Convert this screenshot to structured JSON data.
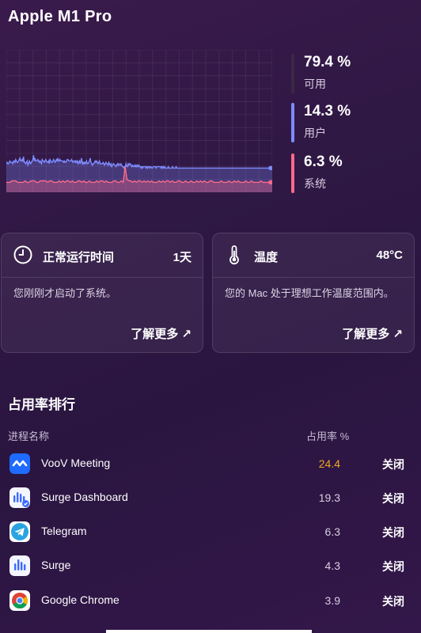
{
  "window": {
    "title": "Apple M1 Pro"
  },
  "cpu_stats": [
    {
      "value": "79.4 %",
      "label": "可用",
      "color": "#3a2a44"
    },
    {
      "value": "14.3 %",
      "label": "用户",
      "color": "#7d8cff"
    },
    {
      "value": "6.3 %",
      "label": "系统",
      "color": "#ff6a8a"
    }
  ],
  "chart_data": {
    "type": "area",
    "series": [
      {
        "name": "用户",
        "color": "#7d8cff",
        "values": [
          20,
          21,
          20,
          20,
          21,
          22,
          21,
          21,
          21,
          20,
          22,
          22,
          21,
          23,
          22,
          21,
          21,
          22,
          23,
          24,
          22,
          22,
          23,
          22,
          25,
          21,
          21,
          20,
          21,
          22,
          19,
          20,
          22,
          21,
          20,
          21,
          22,
          23,
          26,
          22,
          24,
          22,
          22,
          22,
          23,
          22,
          21,
          22,
          21,
          20,
          23,
          22,
          22,
          21,
          22,
          23,
          22,
          21,
          21,
          22,
          20,
          23,
          22,
          21,
          21,
          22,
          23,
          22,
          21,
          22,
          23,
          22,
          24,
          22,
          22,
          23,
          22,
          22,
          22,
          22,
          21,
          22,
          21,
          21,
          22,
          23,
          23,
          22,
          22,
          22,
          22,
          23,
          22,
          21,
          22,
          22,
          21,
          22,
          21,
          22,
          20,
          21,
          22,
          20,
          22,
          24,
          20,
          21,
          20,
          21,
          20,
          21,
          22,
          20,
          20,
          21,
          22,
          24,
          21,
          20,
          19,
          20,
          20,
          21,
          22,
          21,
          22,
          21,
          20,
          21,
          22,
          20,
          20,
          20,
          20,
          21,
          20,
          19,
          20,
          21,
          20,
          20,
          19,
          21,
          20,
          19,
          20,
          18,
          19,
          20,
          20,
          19,
          19,
          18,
          19,
          20,
          19,
          20,
          19,
          19,
          20,
          19,
          18,
          18,
          17,
          18,
          18,
          20,
          18,
          18,
          20,
          19,
          20,
          20,
          19,
          18,
          19,
          18,
          18,
          19,
          18,
          19,
          18,
          19,
          18,
          19,
          18,
          18,
          17,
          18,
          17,
          18,
          18,
          18,
          18,
          17,
          18,
          17,
          18,
          18,
          17,
          18,
          18,
          17,
          17,
          18,
          18,
          18,
          18,
          17,
          18,
          18,
          18,
          18,
          18,
          18,
          17,
          18,
          17,
          18,
          17,
          18,
          17,
          17,
          17,
          17,
          18,
          17,
          17,
          17,
          17,
          17,
          18,
          17,
          17,
          17,
          17,
          18,
          17,
          17,
          17,
          17,
          17,
          17,
          17,
          17,
          17,
          17,
          17,
          17,
          17,
          17,
          17,
          17,
          17,
          17,
          17,
          17,
          17,
          17,
          17,
          17,
          17,
          17,
          17,
          17,
          17,
          17,
          17,
          17,
          17,
          17,
          17,
          17,
          17,
          17,
          17,
          17,
          17,
          17,
          17,
          17,
          17,
          17,
          17,
          17,
          17,
          17,
          17,
          17,
          17,
          17,
          17,
          17,
          17,
          17,
          17,
          17,
          17,
          17,
          17,
          17,
          17,
          17,
          17,
          17,
          17,
          17,
          17,
          17,
          17,
          17,
          17,
          17,
          17,
          17,
          17,
          17,
          17,
          17,
          17,
          17,
          17,
          17,
          17,
          17,
          17,
          17,
          17,
          17,
          17,
          17,
          17,
          17,
          17,
          17,
          17,
          17,
          17,
          17,
          17,
          17,
          17,
          17,
          17,
          17,
          17,
          17,
          17,
          17,
          17,
          17,
          17,
          17,
          17,
          17,
          17,
          17,
          17,
          17,
          17,
          17,
          17,
          17,
          17,
          17,
          17,
          17,
          17,
          17,
          17,
          17
        ]
      },
      {
        "name": "系统",
        "color": "#ff6a8a",
        "values": [
          7,
          7,
          7,
          8,
          8,
          8,
          7,
          7,
          7,
          7,
          8,
          7,
          7,
          8,
          8,
          8,
          7,
          7,
          8,
          8,
          8,
          8,
          7,
          8,
          8,
          7,
          7,
          7,
          8,
          7,
          8,
          7,
          8,
          8,
          7,
          8,
          7,
          7,
          8,
          8,
          7,
          8,
          7,
          7,
          8,
          7,
          7,
          7,
          8,
          7,
          8,
          8,
          7,
          8,
          7,
          7,
          7,
          8,
          8,
          7,
          7,
          8,
          7,
          18,
          9,
          8,
          8,
          7,
          8,
          7,
          8,
          8,
          7,
          8,
          7,
          8,
          7,
          8,
          7,
          7,
          7,
          8,
          7,
          8,
          7,
          8,
          8,
          7,
          8,
          7,
          7,
          8,
          8,
          7,
          7,
          8,
          7,
          7,
          8,
          7,
          7,
          8,
          7,
          8,
          7,
          8,
          7,
          7,
          8,
          8,
          7,
          7,
          7,
          7,
          8,
          7,
          7,
          7,
          8,
          7,
          7,
          8,
          7,
          8,
          7,
          7,
          7,
          8,
          7,
          7,
          8,
          7,
          7,
          7,
          7,
          8,
          7,
          7,
          7,
          7,
          6,
          7
        ]
      }
    ],
    "ylim": [
      0,
      100
    ],
    "grid": true
  },
  "cards": {
    "uptime": {
      "title": "正常运行时间",
      "value": "1天",
      "desc": "您刚刚才启动了系统。",
      "more": "了解更多 ↗"
    },
    "temp": {
      "title": "温度",
      "value": "48°C",
      "desc": "您的 Mac 处于理想工作温度范围内。",
      "more": "了解更多 ↗"
    }
  },
  "ranking": {
    "title": "占用率排行",
    "col_name": "进程名称",
    "col_usage": "占用率 %",
    "close_label": "关闭",
    "rows": [
      {
        "name": "VooV Meeting",
        "value": "24.4",
        "icon": "voov-icon",
        "highlight": true
      },
      {
        "name": "Surge Dashboard",
        "value": "19.3",
        "icon": "surge-dashboard-icon",
        "highlight": false
      },
      {
        "name": "Telegram",
        "value": "6.3",
        "icon": "telegram-icon",
        "highlight": false
      },
      {
        "name": "Surge",
        "value": "4.3",
        "icon": "surge-icon",
        "highlight": false
      },
      {
        "name": "Google Chrome",
        "value": "3.9",
        "icon": "chrome-icon",
        "highlight": false
      }
    ],
    "highlight_color": "#f5a623"
  }
}
